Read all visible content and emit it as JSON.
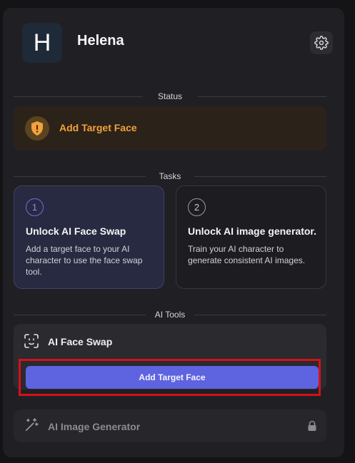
{
  "profile": {
    "avatar_letter": "H",
    "name": "Helena"
  },
  "sections": {
    "status": "Status",
    "tasks": "Tasks",
    "ai_tools": "AI Tools"
  },
  "status_card": {
    "icon": "shield-alert-icon",
    "text": "Add Target Face"
  },
  "tasks": [
    {
      "number": "1",
      "title": "Unlock AI Face Swap",
      "description": "Add a target face to your AI character to use the face swap tool."
    },
    {
      "number": "2",
      "title": "Unlock AI image generator.",
      "description": "Train your AI character to generate consistent AI images."
    }
  ],
  "tools": {
    "face_swap": {
      "icon": "face-scan-icon",
      "name": "AI Face Swap",
      "button_label": "Add Target Face"
    },
    "image_generator": {
      "icon": "magic-wand-icon",
      "name": "AI Image Generator",
      "lock_icon": "lock-icon"
    }
  },
  "colors": {
    "accent": "#5e63e0",
    "warning": "#f4a03c",
    "highlight_border": "#d6101a"
  }
}
